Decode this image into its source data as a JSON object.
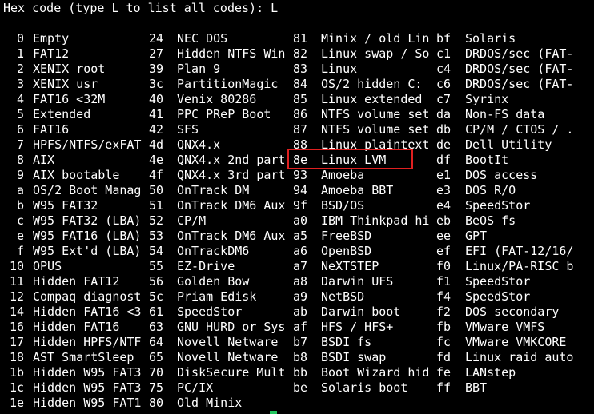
{
  "prompt": "Hex code (type L to list all codes): L",
  "rows": [
    [
      [
        "0",
        "Empty"
      ],
      [
        "24",
        "NEC DOS"
      ],
      [
        "81",
        "Minix / old Lin"
      ],
      [
        "bf",
        "Solaris"
      ]
    ],
    [
      [
        "1",
        "FAT12"
      ],
      [
        "27",
        "Hidden NTFS Win"
      ],
      [
        "82",
        "Linux swap / So"
      ],
      [
        "c1",
        "DRDOS/sec (FAT-"
      ]
    ],
    [
      [
        "2",
        "XENIX root"
      ],
      [
        "39",
        "Plan 9"
      ],
      [
        "83",
        "Linux"
      ],
      [
        "c4",
        "DRDOS/sec (FAT-"
      ]
    ],
    [
      [
        "3",
        "XENIX usr"
      ],
      [
        "3c",
        "PartitionMagic"
      ],
      [
        "84",
        "OS/2 hidden C:"
      ],
      [
        "c6",
        "DRDOS/sec (FAT-"
      ]
    ],
    [
      [
        "4",
        "FAT16 <32M"
      ],
      [
        "40",
        "Venix 80286"
      ],
      [
        "85",
        "Linux extended"
      ],
      [
        "c7",
        "Syrinx"
      ]
    ],
    [
      [
        "5",
        "Extended"
      ],
      [
        "41",
        "PPC PReP Boot"
      ],
      [
        "86",
        "NTFS volume set"
      ],
      [
        "da",
        "Non-FS data"
      ]
    ],
    [
      [
        "6",
        "FAT16"
      ],
      [
        "42",
        "SFS"
      ],
      [
        "87",
        "NTFS volume set"
      ],
      [
        "db",
        "CP/M / CTOS / ."
      ]
    ],
    [
      [
        "7",
        "HPFS/NTFS/exFAT"
      ],
      [
        "4d",
        "QNX4.x"
      ],
      [
        "88",
        "Linux plaintext"
      ],
      [
        "de",
        "Dell Utility"
      ]
    ],
    [
      [
        "8",
        "AIX"
      ],
      [
        "4e",
        "QNX4.x 2nd part"
      ],
      [
        "8e",
        "Linux LVM"
      ],
      [
        "df",
        "BootIt"
      ]
    ],
    [
      [
        "9",
        "AIX bootable"
      ],
      [
        "4f",
        "QNX4.x 3rd part"
      ],
      [
        "93",
        "Amoeba"
      ],
      [
        "e1",
        "DOS access"
      ]
    ],
    [
      [
        "a",
        "OS/2 Boot Manag"
      ],
      [
        "50",
        "OnTrack DM"
      ],
      [
        "94",
        "Amoeba BBT"
      ],
      [
        "e3",
        "DOS R/O"
      ]
    ],
    [
      [
        "b",
        "W95 FAT32"
      ],
      [
        "51",
        "OnTrack DM6 Aux"
      ],
      [
        "9f",
        "BSD/OS"
      ],
      [
        "e4",
        "SpeedStor"
      ]
    ],
    [
      [
        "c",
        "W95 FAT32 (LBA)"
      ],
      [
        "52",
        "CP/M"
      ],
      [
        "a0",
        "IBM Thinkpad hi"
      ],
      [
        "eb",
        "BeOS fs"
      ]
    ],
    [
      [
        "e",
        "W95 FAT16 (LBA)"
      ],
      [
        "53",
        "OnTrack DM6 Aux"
      ],
      [
        "a5",
        "FreeBSD"
      ],
      [
        "ee",
        "GPT"
      ]
    ],
    [
      [
        "f",
        "W95 Ext'd (LBA)"
      ],
      [
        "54",
        "OnTrackDM6"
      ],
      [
        "a6",
        "OpenBSD"
      ],
      [
        "ef",
        "EFI (FAT-12/16/"
      ]
    ],
    [
      [
        "10",
        "OPUS"
      ],
      [
        "55",
        "EZ-Drive"
      ],
      [
        "a7",
        "NeXTSTEP"
      ],
      [
        "f0",
        "Linux/PA-RISC b"
      ]
    ],
    [
      [
        "11",
        "Hidden FAT12"
      ],
      [
        "56",
        "Golden Bow"
      ],
      [
        "a8",
        "Darwin UFS"
      ],
      [
        "f1",
        "SpeedStor"
      ]
    ],
    [
      [
        "12",
        "Compaq diagnost"
      ],
      [
        "5c",
        "Priam Edisk"
      ],
      [
        "a9",
        "NetBSD"
      ],
      [
        "f4",
        "SpeedStor"
      ]
    ],
    [
      [
        "14",
        "Hidden FAT16 <3"
      ],
      [
        "61",
        "SpeedStor"
      ],
      [
        "ab",
        "Darwin boot"
      ],
      [
        "f2",
        "DOS secondary"
      ]
    ],
    [
      [
        "16",
        "Hidden FAT16"
      ],
      [
        "63",
        "GNU HURD or Sys"
      ],
      [
        "af",
        "HFS / HFS+"
      ],
      [
        "fb",
        "VMware VMFS"
      ]
    ],
    [
      [
        "17",
        "Hidden HPFS/NTF"
      ],
      [
        "64",
        "Novell Netware"
      ],
      [
        "b7",
        "BSDI fs"
      ],
      [
        "fc",
        "VMware VMKCORE"
      ]
    ],
    [
      [
        "18",
        "AST SmartSleep"
      ],
      [
        "65",
        "Novell Netware"
      ],
      [
        "b8",
        "BSDI swap"
      ],
      [
        "fd",
        "Linux raid auto"
      ]
    ],
    [
      [
        "1b",
        "Hidden W95 FAT3"
      ],
      [
        "70",
        "DiskSecure Mult"
      ],
      [
        "bb",
        "Boot Wizard hid"
      ],
      [
        "fe",
        "LANstep"
      ]
    ],
    [
      [
        "1c",
        "Hidden W95 FAT3"
      ],
      [
        "75",
        "PC/IX"
      ],
      [
        "be",
        "Solaris boot"
      ],
      [
        "ff",
        "BBT"
      ]
    ],
    [
      [
        "1e",
        "Hidden W95 FAT1"
      ],
      [
        "80",
        "Old Minix"
      ]
    ]
  ],
  "colors": {
    "background": "#000000",
    "text": "#ffffff",
    "highlight": "#e02020",
    "cursor": "#22c55e"
  }
}
